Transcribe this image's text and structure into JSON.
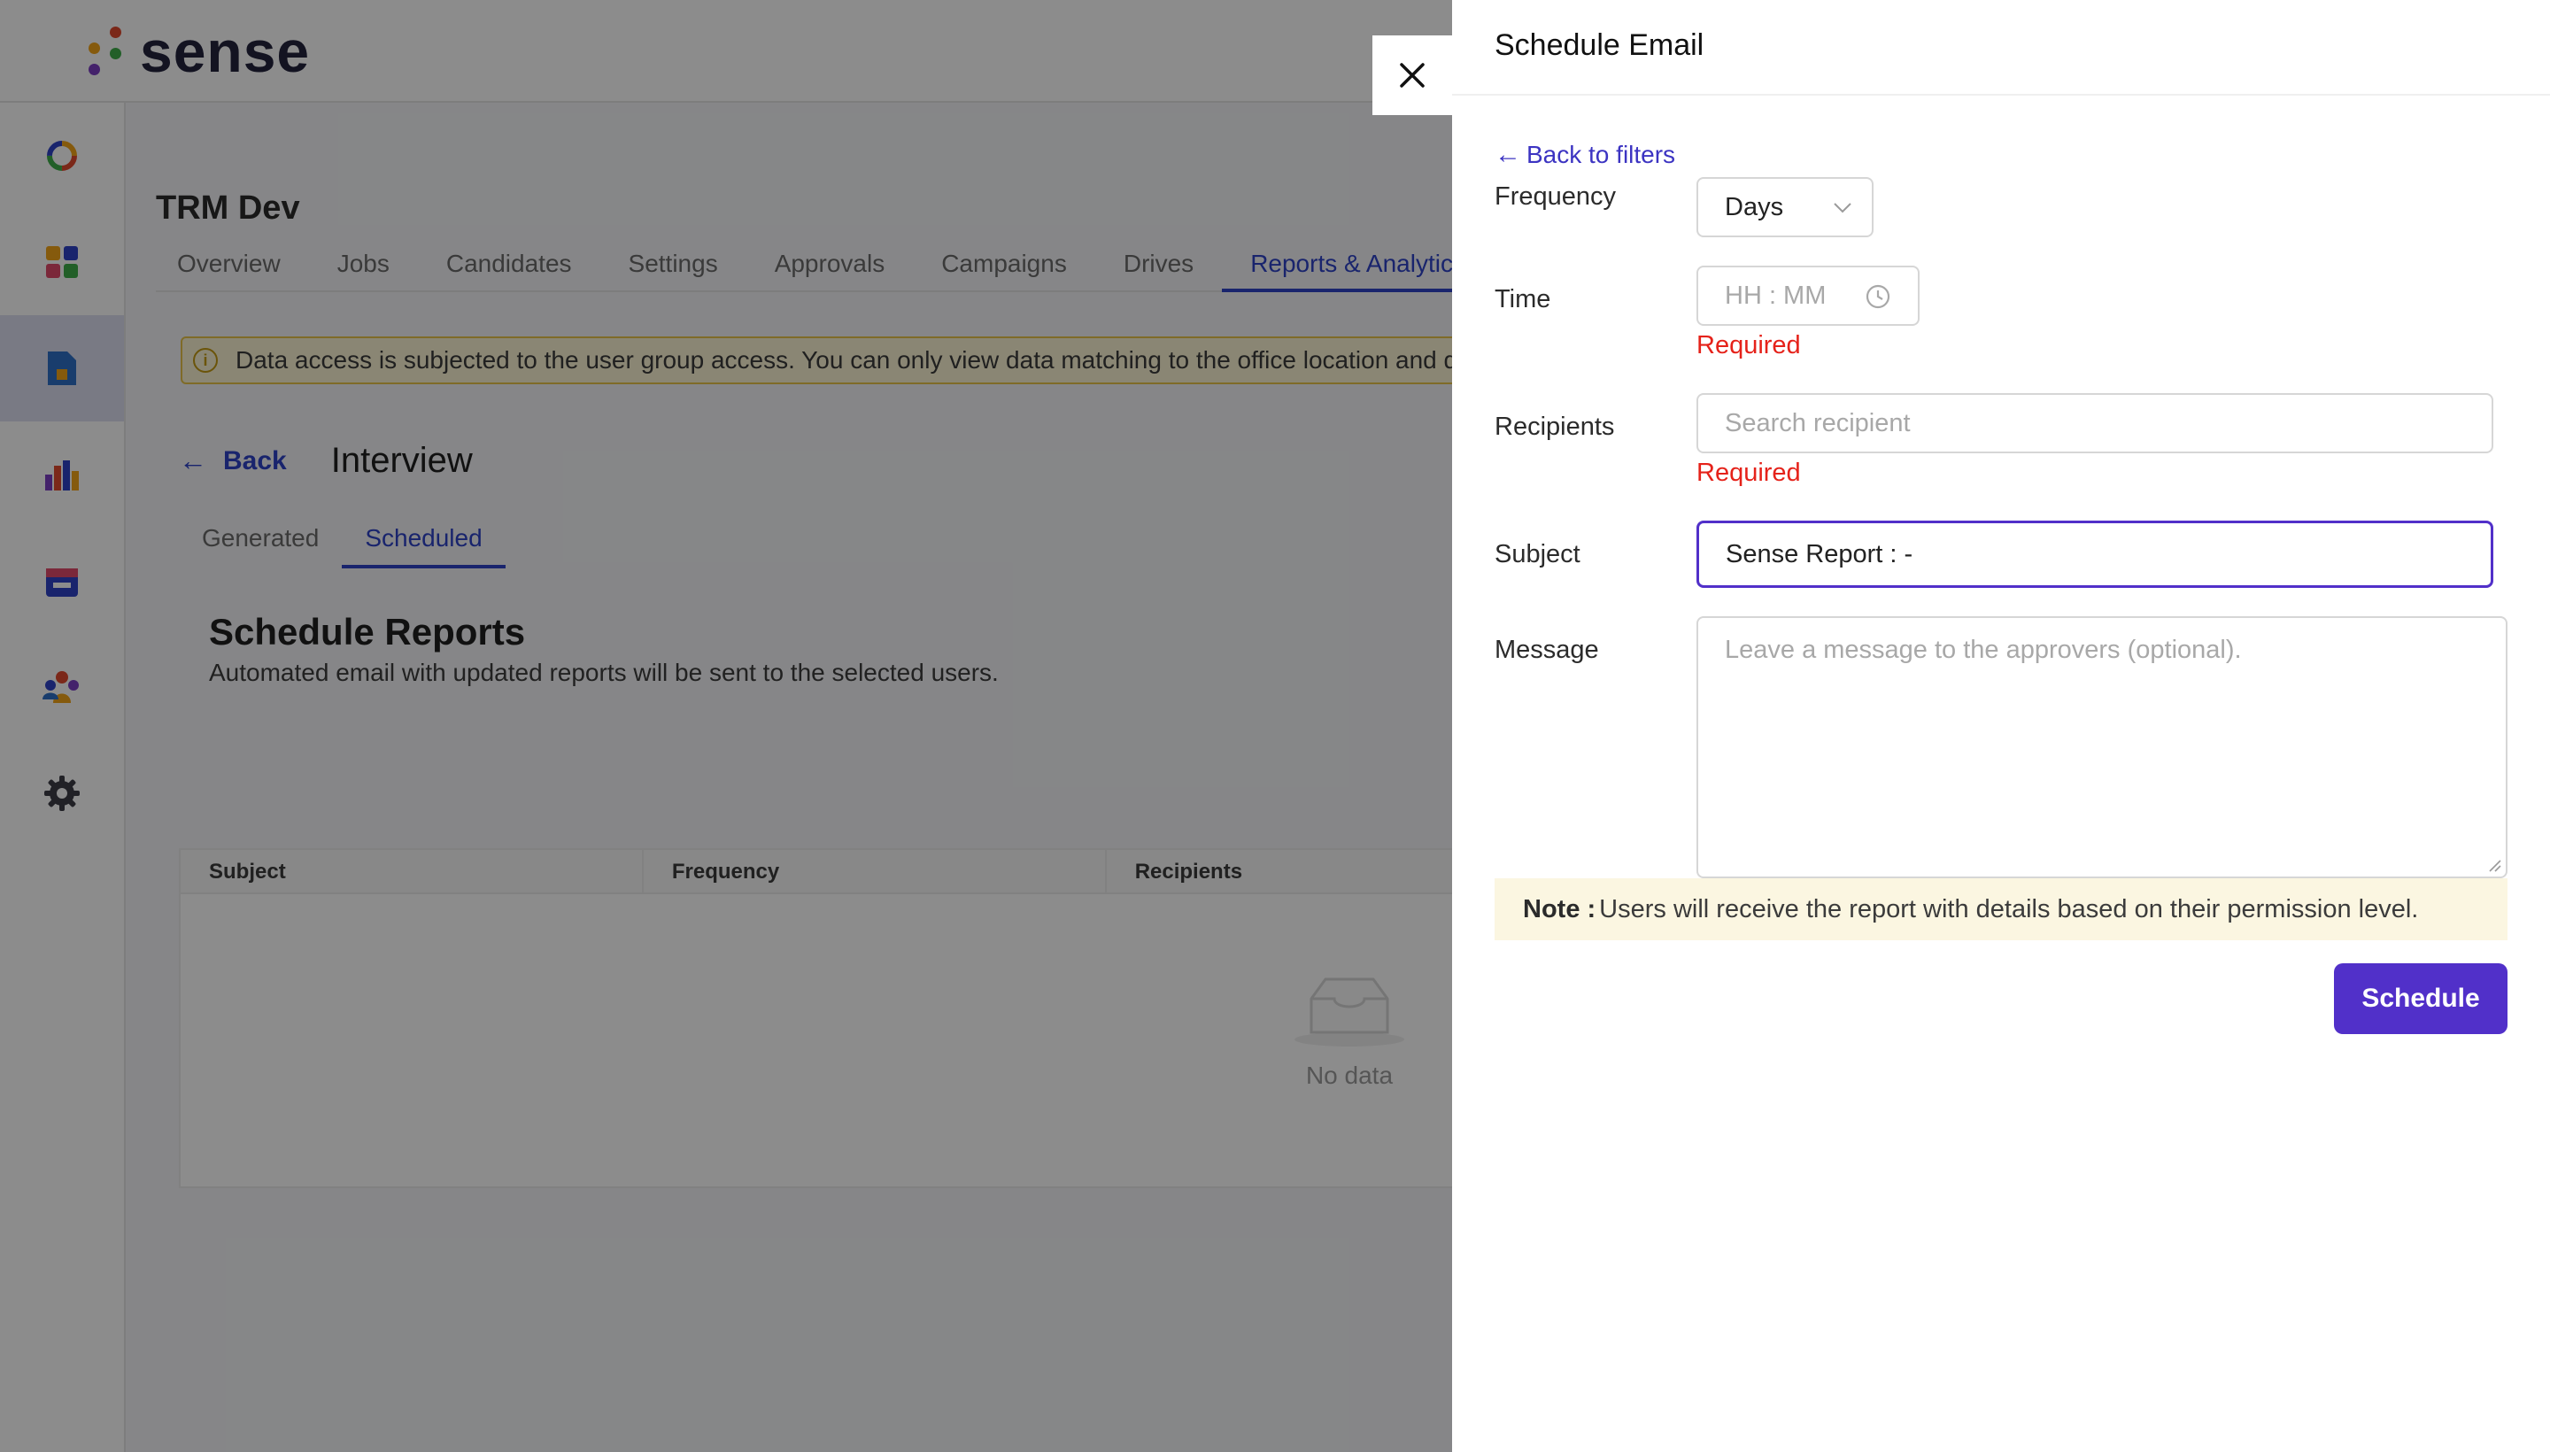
{
  "app": {
    "logo_text": "sense"
  },
  "project": {
    "title": "TRM Dev"
  },
  "tabs": [
    {
      "label": "Overview"
    },
    {
      "label": "Jobs"
    },
    {
      "label": "Candidates"
    },
    {
      "label": "Settings"
    },
    {
      "label": "Approvals"
    },
    {
      "label": "Campaigns"
    },
    {
      "label": "Drives"
    },
    {
      "label": "Reports & Analytics"
    }
  ],
  "notice": {
    "text": "Data access is subjected to the user group access. You can only view data matching to the office location and de"
  },
  "page": {
    "back_label": "Back",
    "heading": "Interview"
  },
  "subtabs": [
    {
      "label": "Generated"
    },
    {
      "label": "Scheduled"
    }
  ],
  "schedule_reports": {
    "title": "Schedule Reports",
    "subtitle": "Automated email with updated reports will be sent to the selected users."
  },
  "table": {
    "columns": [
      "Subject",
      "Frequency",
      "Recipients"
    ],
    "empty_text": "No data"
  },
  "drawer": {
    "title": "Schedule Email",
    "back_to_filters": "Back to filters",
    "frequency": {
      "label": "Frequency",
      "value": "Days"
    },
    "time": {
      "label": "Time",
      "placeholder": "HH : MM",
      "error": "Required"
    },
    "recipients": {
      "label": "Recipients",
      "placeholder": "Search recipient",
      "error": "Required"
    },
    "subject": {
      "label": "Subject",
      "value": "Sense Report : -"
    },
    "message": {
      "label": "Message",
      "placeholder": "Leave a message to the approvers (optional)."
    },
    "note": {
      "prefix": "Note :",
      "text": "Users will receive the report with details based on their permission level."
    },
    "schedule_label": "Schedule"
  },
  "colors": {
    "accent": "#5130c9",
    "link": "#2e43c6",
    "error": "#e5221a",
    "note_bg": "#fbf6e1",
    "focus_border": "#5130c9"
  }
}
